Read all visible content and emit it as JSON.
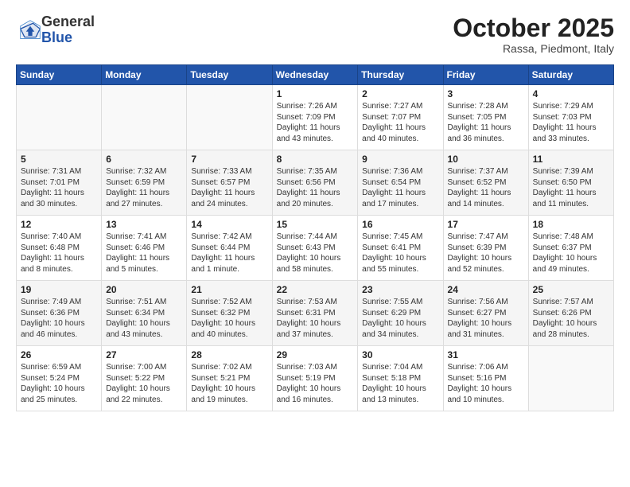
{
  "logo": {
    "general": "General",
    "blue": "Blue"
  },
  "title": "October 2025",
  "location": "Rassa, Piedmont, Italy",
  "weekdays": [
    "Sunday",
    "Monday",
    "Tuesday",
    "Wednesday",
    "Thursday",
    "Friday",
    "Saturday"
  ],
  "weeks": [
    [
      {
        "day": "",
        "info": ""
      },
      {
        "day": "",
        "info": ""
      },
      {
        "day": "",
        "info": ""
      },
      {
        "day": "1",
        "info": "Sunrise: 7:26 AM\nSunset: 7:09 PM\nDaylight: 11 hours\nand 43 minutes."
      },
      {
        "day": "2",
        "info": "Sunrise: 7:27 AM\nSunset: 7:07 PM\nDaylight: 11 hours\nand 40 minutes."
      },
      {
        "day": "3",
        "info": "Sunrise: 7:28 AM\nSunset: 7:05 PM\nDaylight: 11 hours\nand 36 minutes."
      },
      {
        "day": "4",
        "info": "Sunrise: 7:29 AM\nSunset: 7:03 PM\nDaylight: 11 hours\nand 33 minutes."
      }
    ],
    [
      {
        "day": "5",
        "info": "Sunrise: 7:31 AM\nSunset: 7:01 PM\nDaylight: 11 hours\nand 30 minutes."
      },
      {
        "day": "6",
        "info": "Sunrise: 7:32 AM\nSunset: 6:59 PM\nDaylight: 11 hours\nand 27 minutes."
      },
      {
        "day": "7",
        "info": "Sunrise: 7:33 AM\nSunset: 6:57 PM\nDaylight: 11 hours\nand 24 minutes."
      },
      {
        "day": "8",
        "info": "Sunrise: 7:35 AM\nSunset: 6:56 PM\nDaylight: 11 hours\nand 20 minutes."
      },
      {
        "day": "9",
        "info": "Sunrise: 7:36 AM\nSunset: 6:54 PM\nDaylight: 11 hours\nand 17 minutes."
      },
      {
        "day": "10",
        "info": "Sunrise: 7:37 AM\nSunset: 6:52 PM\nDaylight: 11 hours\nand 14 minutes."
      },
      {
        "day": "11",
        "info": "Sunrise: 7:39 AM\nSunset: 6:50 PM\nDaylight: 11 hours\nand 11 minutes."
      }
    ],
    [
      {
        "day": "12",
        "info": "Sunrise: 7:40 AM\nSunset: 6:48 PM\nDaylight: 11 hours\nand 8 minutes."
      },
      {
        "day": "13",
        "info": "Sunrise: 7:41 AM\nSunset: 6:46 PM\nDaylight: 11 hours\nand 5 minutes."
      },
      {
        "day": "14",
        "info": "Sunrise: 7:42 AM\nSunset: 6:44 PM\nDaylight: 11 hours\nand 1 minute."
      },
      {
        "day": "15",
        "info": "Sunrise: 7:44 AM\nSunset: 6:43 PM\nDaylight: 10 hours\nand 58 minutes."
      },
      {
        "day": "16",
        "info": "Sunrise: 7:45 AM\nSunset: 6:41 PM\nDaylight: 10 hours\nand 55 minutes."
      },
      {
        "day": "17",
        "info": "Sunrise: 7:47 AM\nSunset: 6:39 PM\nDaylight: 10 hours\nand 52 minutes."
      },
      {
        "day": "18",
        "info": "Sunrise: 7:48 AM\nSunset: 6:37 PM\nDaylight: 10 hours\nand 49 minutes."
      }
    ],
    [
      {
        "day": "19",
        "info": "Sunrise: 7:49 AM\nSunset: 6:36 PM\nDaylight: 10 hours\nand 46 minutes."
      },
      {
        "day": "20",
        "info": "Sunrise: 7:51 AM\nSunset: 6:34 PM\nDaylight: 10 hours\nand 43 minutes."
      },
      {
        "day": "21",
        "info": "Sunrise: 7:52 AM\nSunset: 6:32 PM\nDaylight: 10 hours\nand 40 minutes."
      },
      {
        "day": "22",
        "info": "Sunrise: 7:53 AM\nSunset: 6:31 PM\nDaylight: 10 hours\nand 37 minutes."
      },
      {
        "day": "23",
        "info": "Sunrise: 7:55 AM\nSunset: 6:29 PM\nDaylight: 10 hours\nand 34 minutes."
      },
      {
        "day": "24",
        "info": "Sunrise: 7:56 AM\nSunset: 6:27 PM\nDaylight: 10 hours\nand 31 minutes."
      },
      {
        "day": "25",
        "info": "Sunrise: 7:57 AM\nSunset: 6:26 PM\nDaylight: 10 hours\nand 28 minutes."
      }
    ],
    [
      {
        "day": "26",
        "info": "Sunrise: 6:59 AM\nSunset: 5:24 PM\nDaylight: 10 hours\nand 25 minutes."
      },
      {
        "day": "27",
        "info": "Sunrise: 7:00 AM\nSunset: 5:22 PM\nDaylight: 10 hours\nand 22 minutes."
      },
      {
        "day": "28",
        "info": "Sunrise: 7:02 AM\nSunset: 5:21 PM\nDaylight: 10 hours\nand 19 minutes."
      },
      {
        "day": "29",
        "info": "Sunrise: 7:03 AM\nSunset: 5:19 PM\nDaylight: 10 hours\nand 16 minutes."
      },
      {
        "day": "30",
        "info": "Sunrise: 7:04 AM\nSunset: 5:18 PM\nDaylight: 10 hours\nand 13 minutes."
      },
      {
        "day": "31",
        "info": "Sunrise: 7:06 AM\nSunset: 5:16 PM\nDaylight: 10 hours\nand 10 minutes."
      },
      {
        "day": "",
        "info": ""
      }
    ]
  ]
}
